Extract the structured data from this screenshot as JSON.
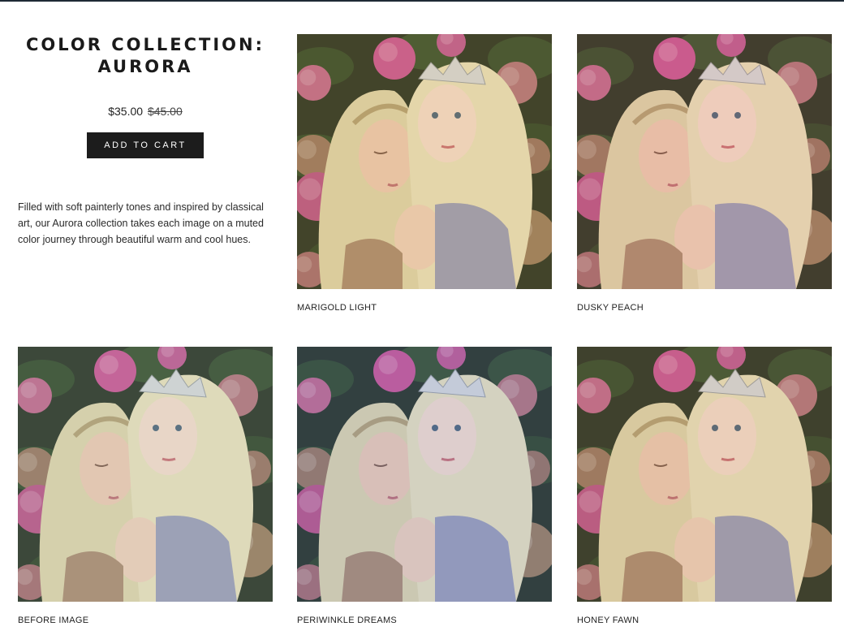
{
  "product": {
    "title": "COLOR COLLECTION: AURORA",
    "price_current": "$35.00",
    "price_original": "$45.00",
    "add_to_cart_label": "ADD TO CART",
    "description": "Filled with soft painterly tones and inspired by classical art, our Aurora collection takes each image on a muted color journey through beautiful warm and cool hues."
  },
  "gallery": [
    {
      "caption": "MARIGOLD LIGHT",
      "tint": "#e8c27a"
    },
    {
      "caption": "DUSKY PEACH",
      "tint": "#e9a98f"
    },
    {
      "caption": "BEFORE IMAGE",
      "tint": "#cfd7c4"
    },
    {
      "caption": "PERIWINKLE DREAMS",
      "tint": "#9fb0e0"
    },
    {
      "caption": "HONEY FAWN",
      "tint": "#d9b48a"
    }
  ],
  "colors": {
    "topbar": "#1e2a35",
    "button_bg": "#1c1c1c",
    "button_text": "#ffffff"
  }
}
